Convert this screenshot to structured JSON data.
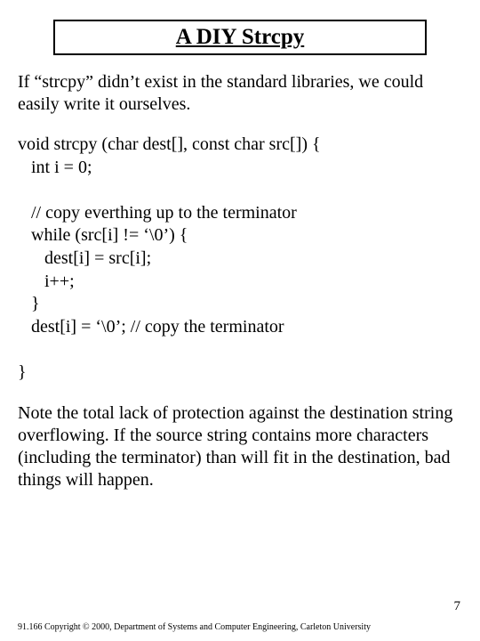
{
  "title": "A DIY Strcpy",
  "intro": "If “strcpy” didn’t exist in the standard libraries, we could easily write it ourselves.",
  "code": {
    "l1": "void strcpy (char dest[], const char src[]) {",
    "l2": "   int i = 0;",
    "l3": "   // copy everthing up to the terminator",
    "l4": "   while (src[i] != ‘\\0’) {",
    "l5": "      dest[i] = src[i];",
    "l6": "      i++;",
    "l7": "   }",
    "l8": "   dest[i] = ‘\\0’; // copy the terminator",
    "l9": "}"
  },
  "note": "Note the total lack of protection against the destination string overflowing.  If the source string contains more characters (including the terminator) than will fit in the destination, bad things will happen.",
  "pagenum": "7",
  "footer": "91.166 Copyright © 2000, Department of Systems and Computer Engineering, Carleton University"
}
